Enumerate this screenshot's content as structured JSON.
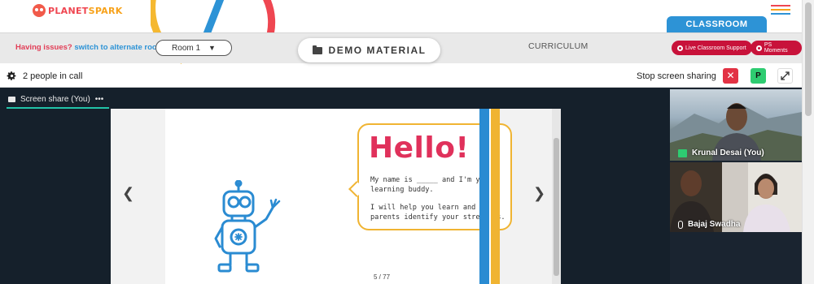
{
  "brand": {
    "logo_part1": "PLANET",
    "logo_part2": "SPARK"
  },
  "header": {
    "classroom_tab": "CLASSROOM"
  },
  "controls": {
    "issues_text": "Having issues?",
    "switch_link": "switch to alternate room",
    "room_value": "Room 1",
    "demo_material": "DEMO MATERIAL",
    "curriculum": "CURRICULUM",
    "support_button": "Live Classroom Support",
    "moments_button": "PS Moments"
  },
  "call": {
    "people_count": "2 people in call",
    "stop_sharing": "Stop screen sharing",
    "p_button": "P"
  },
  "screen_share": {
    "tab_label": "Screen share (You)",
    "tab_menu": "•••"
  },
  "slide": {
    "heading": "Hello!",
    "line1": "My name is _____ and I'm your learning buddy.",
    "line2": "I will help you learn and your parents identify your strengths.",
    "page": "5 / 77"
  },
  "participants": [
    {
      "name": "Krunal Desai (You)"
    },
    {
      "name": "Bajaj Swadha"
    }
  ],
  "colors": {
    "accent_red": "#e23e57",
    "accent_blue": "#2d93d6",
    "brand_red": "#ef4651",
    "brand_orange": "#f7a21b",
    "hello_pink": "#e0315b",
    "slide_yellow": "#f0b432",
    "stage_bg": "#15202b"
  }
}
